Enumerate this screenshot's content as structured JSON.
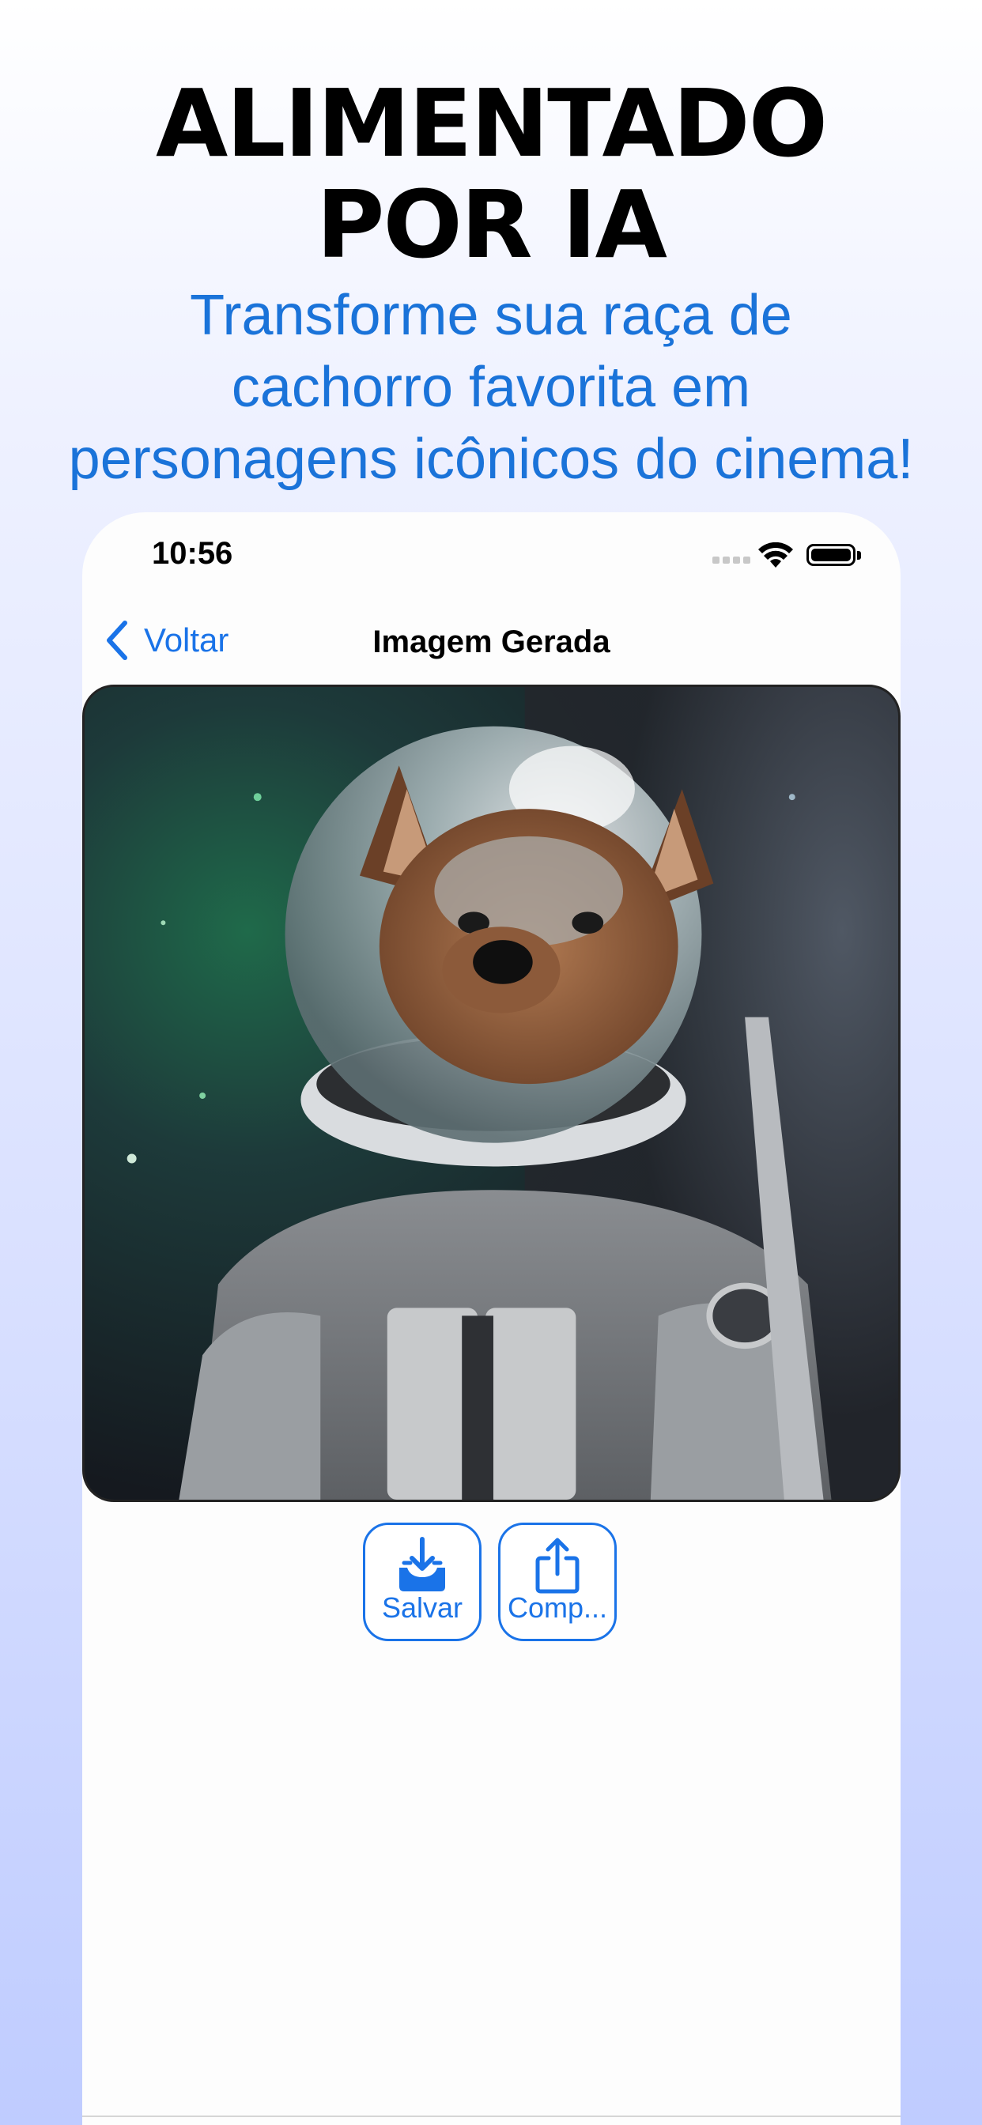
{
  "hero": {
    "title_line1": "ALIMENTADO",
    "title_line2": "POR IA",
    "subtitle_line1": "Transforme sua raça de",
    "subtitle_line2": "cachorro favorita em",
    "subtitle_line3": "personagens icônicos do cinema!"
  },
  "status_bar": {
    "time": "10:56"
  },
  "nav": {
    "back_label": "Voltar",
    "title": "Imagem Gerada"
  },
  "image": {
    "subject_icon": "dog-astronaut-image"
  },
  "actions": {
    "save_label": "Salvar",
    "share_label": "Comp..."
  },
  "colors": {
    "accent": "#1a73e8",
    "subtitle": "#1a73d9"
  }
}
